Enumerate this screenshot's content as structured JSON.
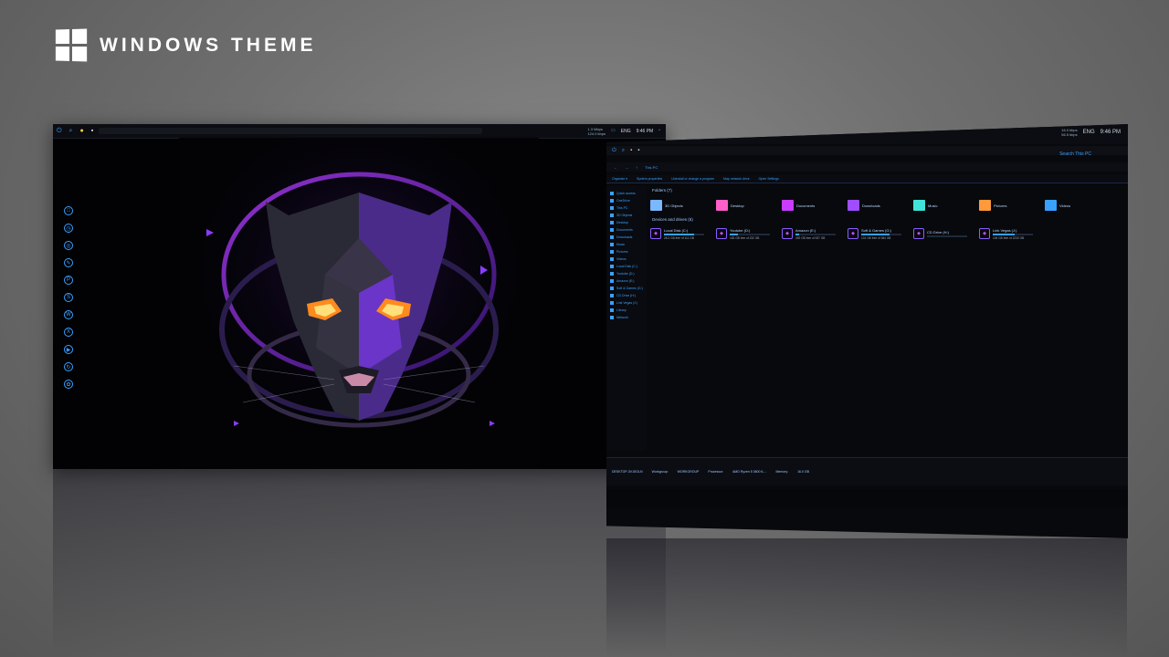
{
  "brand": {
    "title": "WINDOWS THEME"
  },
  "desktop": {
    "taskbar": {
      "net_up": "1.3 Mbps",
      "net_down": "124.0 kbps",
      "lang": "ENG",
      "time": "9:46 PM"
    },
    "icons": [
      {
        "name": "chat-icon",
        "glyph": "□"
      },
      {
        "name": "history-icon",
        "glyph": "◷"
      },
      {
        "name": "chrome-icon",
        "glyph": "◎"
      },
      {
        "name": "pen-icon",
        "glyph": "✎"
      },
      {
        "name": "p-app-icon",
        "glyph": "P"
      },
      {
        "name": "s-app-icon",
        "glyph": "S"
      },
      {
        "name": "w-app-icon",
        "glyph": "W"
      },
      {
        "name": "x-app-icon",
        "glyph": "X"
      },
      {
        "name": "play-icon",
        "glyph": "▶"
      },
      {
        "name": "sync-icon",
        "glyph": "↻"
      },
      {
        "name": "settings-icon",
        "glyph": "✿"
      }
    ]
  },
  "explorer": {
    "tray": {
      "net_up": "16.0 kbps",
      "net_down": "56.5 kbps",
      "lang": "ENG",
      "time": "9:46 PM"
    },
    "title_icons": [
      "folder-icon",
      "check-icon",
      "save-icon"
    ],
    "address": "This PC",
    "search_placeholder": "Search This PC",
    "ribbon": [
      "Organize ▾",
      "System properties",
      "Uninstall or change a program",
      "Map network drive",
      "Open Settings"
    ],
    "sidebar": [
      "Quick access",
      "OneDrive",
      "This PC",
      "3D Objects",
      "Desktop",
      "Documents",
      "Downloads",
      "Music",
      "Pictures",
      "Videos",
      "Local Disk (C:)",
      "Youtube (D:)",
      "Amazon (E:)",
      "Soft & Games (G:)",
      "CD Drive (H:)",
      "Link Vegas (J:)",
      "Library",
      "Network"
    ],
    "folders_header": "Folders (7)",
    "folders": [
      {
        "label": "3D Objects",
        "color": "#7ab8ff"
      },
      {
        "label": "Desktop",
        "color": "#ff5fc8"
      },
      {
        "label": "Documents",
        "color": "#c93cff"
      },
      {
        "label": "Downloads",
        "color": "#a04cff"
      },
      {
        "label": "Music",
        "color": "#41e3d9"
      },
      {
        "label": "Pictures",
        "color": "#ff9a3c"
      },
      {
        "label": "Videos",
        "color": "#3aa0ff"
      }
    ],
    "drives_header": "Devices and drives (6)",
    "drives": [
      {
        "label": "Local Disk (C:)",
        "sub": "28.3 GB free of 111 GB",
        "fill": 0.75
      },
      {
        "label": "Youtube (D:)",
        "sub": "183 GB free of 232 GB",
        "fill": 0.2
      },
      {
        "label": "Amazon (E:)",
        "sub": "492 GB free of 537 GB",
        "fill": 0.1
      },
      {
        "label": "Soft & Games (G:)",
        "sub": "101 GB free of 384 GB",
        "fill": 0.7
      },
      {
        "label": "CD Drive (H:)",
        "sub": "",
        "fill": 0
      },
      {
        "label": "Link Vegas (J:)",
        "sub": "106 GB free of 2233 GB",
        "fill": 0.55
      }
    ],
    "status": {
      "computer": "DESKTOP-3V1SGLN",
      "workgroup_label": "Workgroup:",
      "workgroup": "WORKGROUP",
      "processor_label": "Processor:",
      "processor": "AMD Ryzen 5 3600 6-...",
      "memory_label": "Memory:",
      "memory": "16.0 GB"
    }
  }
}
